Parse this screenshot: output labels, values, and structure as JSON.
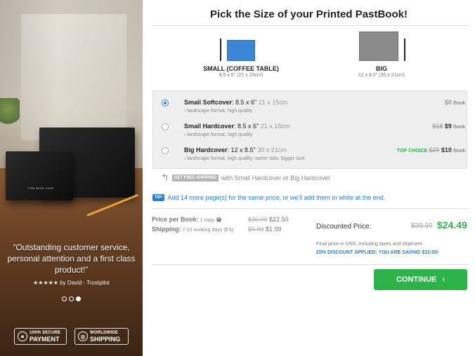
{
  "title": "Pick the Size of your Printed PastBook!",
  "sizes": [
    {
      "name": "SMALL (COFFEE TABLE)",
      "dims": "8.5 x 6\" (21 x 15cm)",
      "color": "#3b87d6"
    },
    {
      "name": "BIG",
      "dims": "12 x 8.5\" (30 x 21cm)",
      "color": "#8b8b8b"
    }
  ],
  "options": [
    {
      "name": "Small Softcover",
      "size": ": 8.5 x 6\"",
      "cm": " 21 x 15cm",
      "sub": "› landscape format, high quality",
      "price_old": "",
      "price": "$0",
      "per_book": " /book",
      "selected": true
    },
    {
      "name": "Small Hardcover",
      "size": ": 8.5 x 6\"",
      "cm": " 21 x 15cm",
      "sub": "› landscape format, high quality",
      "price_old": "$18",
      "price": "$9",
      "per_book": " /book",
      "selected": false
    },
    {
      "name": "Big Hardcover",
      "size": ": 12 x 8.5\"",
      "cm": " 30 x 21cm",
      "sub": "› landscape format, high quality: same ratio, bigger size",
      "top_choice": "TOP CHOICE",
      "price_old": "$20",
      "price": "$10",
      "per_book": " /book",
      "selected": false
    }
  ],
  "shipping_note": {
    "tag": "GET FREE SHIPPING",
    "text": "with Small Hardcover or Big Hardcover"
  },
  "tip": {
    "tag": "TIP!",
    "text": "Add 14 more page(s) for the same price, or we'll add them in white at the end."
  },
  "pricing": {
    "per_book_label": "Price per Book:",
    "per_book_qty": " 1 copy",
    "per_book_old": "$30.00",
    "per_book_new": " $22.50",
    "shipping_label": "Shipping:",
    "shipping_days": " 7-10 working days (ES)",
    "shipping_old": "$9.99",
    "shipping_new": " $1.99",
    "discounted_label": "Discounted Price:",
    "discounted_old": "$39.99",
    "discounted_new": "$24.49",
    "final_note": "Final price in USD, including taxes and shipment.",
    "saving": "25% DISCOUNT APPLIED: YOU ARE SAVING $15.50!"
  },
  "continue_label": "CONTINUE",
  "testimonial": {
    "quote": "“Outstanding customer service, personal attention and a first class product!”",
    "stars": "★★★★★",
    "by": " by David - Trustpilot"
  },
  "book_spine": "PIPA BEAR YEAR",
  "badges": [
    {
      "small": "100% SECURE",
      "large": "PAYMENT",
      "icon": "lock-icon"
    },
    {
      "small": "WORLDWIDE",
      "large": "SHIPPING",
      "icon": "globe-icon"
    }
  ]
}
